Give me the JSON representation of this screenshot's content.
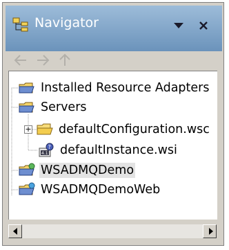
{
  "view": {
    "title": "Navigator",
    "menu_icon": "view-menu-triangle-icon",
    "close_icon": "close-icon"
  },
  "nav_toolbar": {
    "back_icon": "back-arrow-icon",
    "forward_icon": "forward-arrow-icon",
    "up_icon": "up-arrow-icon"
  },
  "tree": {
    "items": [
      {
        "label": "Installed Resource Adapters",
        "icon": "project-folder-icon"
      },
      {
        "label": "Servers",
        "icon": "project-folder-icon"
      },
      {
        "label": "defaultConfiguration.wsc",
        "icon": "folder-icon",
        "expander": "+"
      },
      {
        "label": "defaultInstance.wsi",
        "icon": "server-instance-icon"
      },
      {
        "label": "WSADMQDemo",
        "icon": "ejb-project-icon",
        "selected": true
      },
      {
        "label": "WSADMQDemoWeb",
        "icon": "web-project-icon"
      }
    ]
  },
  "colors": {
    "title_gradient_top": "#9dbcd9",
    "title_gradient_bottom": "#6b93bb",
    "panel_bg": "#d4d0c8",
    "tree_bg": "#ffffff",
    "selection_bg": "#e3e3e3"
  }
}
